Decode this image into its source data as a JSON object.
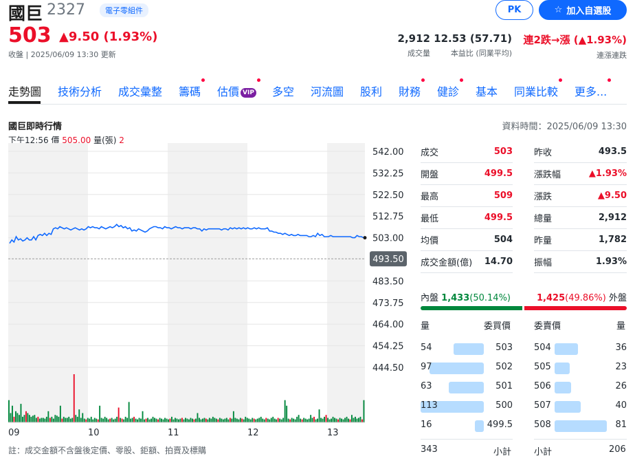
{
  "stock": {
    "name": "國巨",
    "code": "2327",
    "industry_tag": "電子零組件",
    "price": "503",
    "change": "▲9.50 (1.93%)",
    "updated": "收盤 | 2025/06/09 13:30 更新"
  },
  "buttons": {
    "pk": "PK",
    "watchlist": "加入自選股",
    "watchlist_icon": "star-icon"
  },
  "stats": {
    "volume": {
      "value": "2,912",
      "label": "成交量"
    },
    "pe": {
      "value": "12.53 (57.71)",
      "label": "本益比 (同業平均)"
    },
    "streak": {
      "value": "連2跌→漲 (▲1.93%)",
      "label": "連漲連跌"
    }
  },
  "tabs": [
    {
      "label": "走勢圖",
      "dot": false,
      "active": true
    },
    {
      "label": "技術分析",
      "dot": false
    },
    {
      "label": "成交彙整",
      "dot": false
    },
    {
      "label": "籌碼",
      "dot": true
    },
    {
      "label": "估價",
      "dot": true,
      "vip": "VIP"
    },
    {
      "label": "多空",
      "dot": false
    },
    {
      "label": "河流圖",
      "dot": false
    },
    {
      "label": "股利",
      "dot": false
    },
    {
      "label": "財務",
      "dot": true
    },
    {
      "label": "健診",
      "dot": true
    },
    {
      "label": "基本",
      "dot": false
    },
    {
      "label": "同業比較",
      "dot": true
    },
    {
      "label": "更多...",
      "dot": true
    }
  ],
  "chart_section": {
    "title": "國巨即時行情",
    "data_time": "資料時間：2025/06/09 13:30",
    "hover": {
      "time": "下午12:56",
      "price_label": "價",
      "price": "505.00",
      "vol_label": "量(張)",
      "vol": "2"
    },
    "note": "註：成交金額不含盤後定價、零股、鉅額、拍賣及標購"
  },
  "chart_data": {
    "type": "line",
    "x_ticks": [
      "09",
      "10",
      "11",
      "12",
      "13"
    ],
    "y_ticks": [
      "542.00",
      "532.25",
      "522.50",
      "512.75",
      "503.00",
      "493.50",
      "483.50",
      "473.75",
      "464.00",
      "454.25",
      "444.50"
    ],
    "ylim": [
      444.5,
      542
    ],
    "reference_price": 493.5,
    "last_price": 503,
    "price_series": [
      500.5,
      502,
      501,
      503.5,
      502,
      502.5,
      501.5,
      502,
      503,
      502,
      502,
      503.5,
      502,
      504,
      504.5,
      504,
      505,
      504,
      505,
      504.5,
      507,
      507.5,
      507,
      508,
      507.5,
      507,
      507.5,
      507,
      506.5,
      507,
      507.5,
      507,
      506.5,
      507,
      506.5,
      507,
      508,
      507.5,
      508,
      507.5,
      507.5,
      507,
      508,
      507.5,
      507,
      507.5,
      508,
      507.5,
      508,
      509,
      508,
      508.5,
      507.5,
      508,
      507,
      507.5,
      506,
      506.5,
      506,
      507,
      506.5,
      506,
      505.5,
      506,
      507,
      507.5,
      508,
      508,
      507.5,
      507.5,
      507,
      508,
      507.5,
      507.5,
      507,
      507.5,
      508,
      507.5,
      507.5,
      507,
      507.5,
      507.5,
      507.5,
      507,
      507.5,
      507.5,
      507,
      507,
      506,
      507,
      506.5,
      507,
      507,
      507,
      507,
      507,
      507,
      506.5,
      507,
      507,
      506.5,
      507.5,
      507,
      507.5,
      507,
      507.5,
      507,
      507.5,
      507,
      507.5,
      507,
      507,
      507.5,
      507,
      507.5,
      507,
      507,
      507,
      507.5,
      506,
      506,
      505.5,
      505.5,
      505,
      505,
      504.5,
      505,
      504.5,
      504,
      504.5,
      504,
      504,
      504.5,
      504,
      504,
      504,
      504,
      503.5,
      503.5,
      504,
      503.5,
      505,
      504,
      504.5,
      503.5,
      503.5,
      503.5,
      504,
      503.5,
      503.5,
      503.5,
      503.5,
      503.5,
      503.5,
      503.5,
      503.5,
      503.5,
      503,
      503,
      504,
      503.5,
      503.5,
      503
    ],
    "volume_series": [
      60,
      25,
      45,
      15,
      30,
      25,
      20,
      50,
      15,
      20,
      30,
      25,
      20,
      15,
      18,
      20,
      12,
      15,
      10,
      12,
      12,
      10,
      15,
      30,
      12,
      15,
      10,
      20,
      18,
      15,
      45,
      10,
      15,
      12,
      12,
      15,
      10,
      12,
      130,
      20,
      15,
      35,
      12,
      25,
      10,
      8,
      12,
      10,
      15,
      8,
      12,
      10,
      8,
      45,
      12,
      10,
      15,
      12,
      8,
      10,
      12,
      8,
      10,
      15,
      40,
      12,
      10,
      8,
      15,
      12,
      55,
      10,
      12,
      15,
      10,
      8,
      12,
      10,
      30,
      8,
      10,
      12,
      8,
      10,
      15,
      12,
      10,
      8,
      12,
      10,
      8,
      12,
      10,
      8,
      10,
      15,
      8,
      12,
      10,
      8,
      10,
      12,
      8,
      12,
      10,
      8,
      12,
      10,
      8,
      10,
      25,
      12,
      8,
      10,
      12,
      10,
      8,
      12,
      10,
      15,
      12,
      10,
      8,
      12,
      10,
      8,
      10,
      12,
      8,
      12,
      10,
      30,
      12,
      10,
      8,
      12,
      10,
      8,
      15,
      12,
      10,
      8,
      12,
      10,
      8,
      10,
      12,
      15,
      10,
      8,
      12,
      10,
      8,
      12,
      15,
      10,
      8,
      12,
      10,
      8,
      12,
      60,
      45,
      10,
      8,
      12,
      10,
      8,
      15,
      20,
      10,
      8,
      12,
      10,
      8,
      10,
      20,
      12,
      15,
      8,
      10,
      35,
      12,
      10,
      15,
      20,
      12,
      8,
      10,
      15,
      12,
      10,
      8,
      12,
      10,
      8,
      12,
      15,
      10,
      8,
      20,
      12,
      15,
      10,
      12,
      15,
      8,
      60
    ],
    "volume_max": 130
  },
  "quote": {
    "left": [
      {
        "label": "成交",
        "value": "503",
        "color": "red"
      },
      {
        "label": "開盤",
        "value": "499.5",
        "color": "red"
      },
      {
        "label": "最高",
        "value": "509",
        "color": "red"
      },
      {
        "label": "最低",
        "value": "499.5",
        "color": "red"
      },
      {
        "label": "均價",
        "value": "504",
        "color": "black"
      },
      {
        "label": "成交金額(億)",
        "value": "14.70",
        "color": "black"
      }
    ],
    "right": [
      {
        "label": "昨收",
        "value": "493.5",
        "color": "black"
      },
      {
        "label": "漲跌幅",
        "value": "▲1.93%",
        "color": "red"
      },
      {
        "label": "漲跌",
        "value": "▲9.50",
        "color": "red"
      },
      {
        "label": "總量",
        "value": "2,912",
        "color": "black"
      },
      {
        "label": "昨量",
        "value": "1,782",
        "color": "black"
      },
      {
        "label": "振幅",
        "value": "1.93%",
        "color": "black"
      }
    ]
  },
  "inout": {
    "in_label": "內盤",
    "in_value": "1,433",
    "in_pct": "(50.14%)",
    "out_value": "1,425",
    "out_pct": "(49.86%)",
    "out_label": "外盤"
  },
  "orderbook": {
    "bid_headers": [
      "量",
      "委買價"
    ],
    "ask_headers": [
      "委賣價",
      "量"
    ],
    "bids": [
      {
        "qty": "54",
        "price": "503",
        "level": 54
      },
      {
        "qty": "97",
        "price": "502",
        "level": 97
      },
      {
        "qty": "63",
        "price": "501",
        "level": 63
      },
      {
        "qty": "113",
        "price": "500",
        "level": 113
      },
      {
        "qty": "16",
        "price": "499.5",
        "level": 16
      }
    ],
    "asks": [
      {
        "price": "504",
        "qty": "36",
        "level": 36
      },
      {
        "price": "505",
        "qty": "23",
        "level": 23
      },
      {
        "price": "506",
        "qty": "26",
        "level": 26
      },
      {
        "price": "507",
        "qty": "40",
        "level": 40
      },
      {
        "price": "508",
        "qty": "81",
        "level": 81
      }
    ],
    "bid_total": "343",
    "subtotal_label": "小計",
    "ask_total": "206"
  }
}
